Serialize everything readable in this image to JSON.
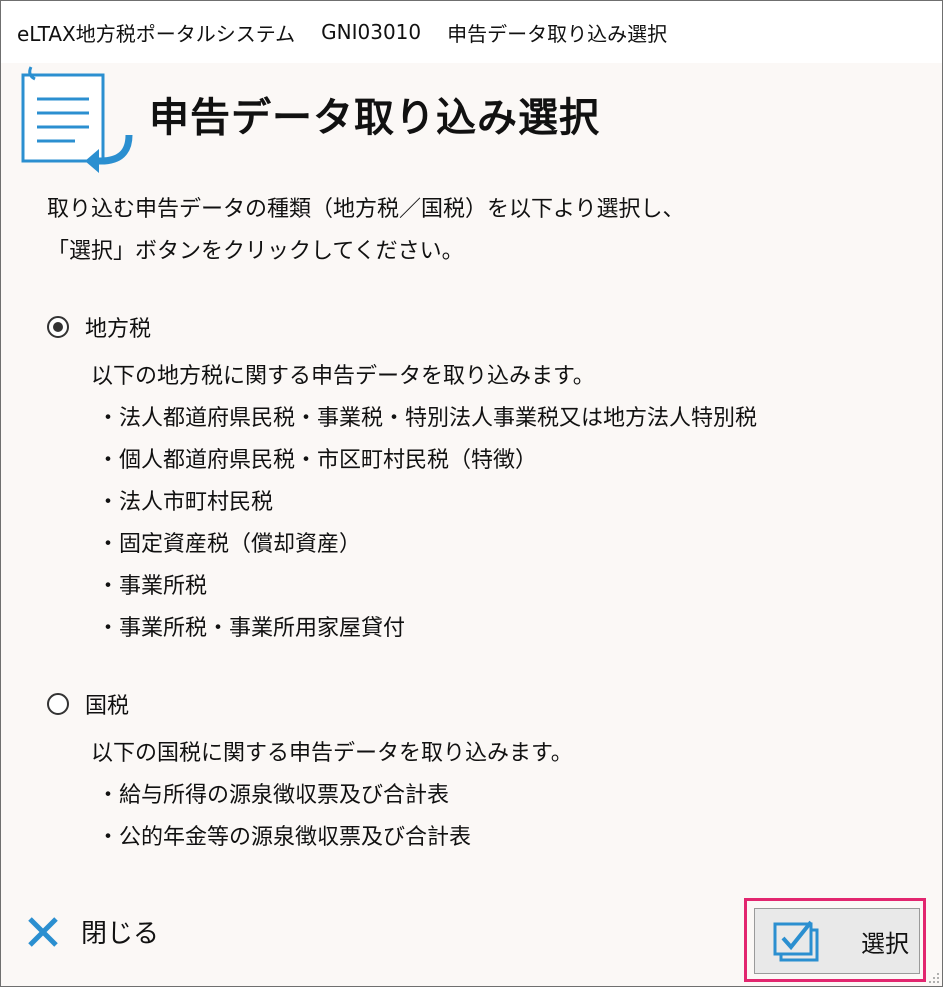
{
  "titlebar": {
    "app_name": "eLTAX地方税ポータルシステム",
    "screen_id": "GNI03010",
    "screen_title": "申告データ取り込み選択"
  },
  "header": {
    "title": "申告データ取り込み選択"
  },
  "instructions": {
    "line1": "取り込む申告データの種類（地方税／国税）を以下より選択し、",
    "line2": "「選択」ボタンをクリックしてください。"
  },
  "options": [
    {
      "label": "地方税",
      "selected": true,
      "description": "以下の地方税に関する申告データを取り込みます。",
      "items": [
        "・法人都道府県民税・事業税・特別法人事業税又は地方法人特別税",
        "・個人都道府県民税・市区町村民税（特徴）",
        "・法人市町村民税",
        "・固定資産税（償却資産）",
        "・事業所税",
        "・事業所税・事業所用家屋貸付"
      ]
    },
    {
      "label": "国税",
      "selected": false,
      "description": "以下の国税に関する申告データを取り込みます。",
      "items": [
        "・給与所得の源泉徴収票及び合計表",
        "・公的年金等の源泉徴収票及び合計表"
      ]
    }
  ],
  "footer": {
    "close_label": "閉じる",
    "select_label": "選択"
  },
  "colors": {
    "accent_blue": "#2b8fd0",
    "highlight_pink": "#e2266f",
    "background": "#fbf8f6"
  },
  "icons": {
    "header": "document-import-icon",
    "close": "close-x-icon",
    "select": "checkbox-check-icon"
  }
}
